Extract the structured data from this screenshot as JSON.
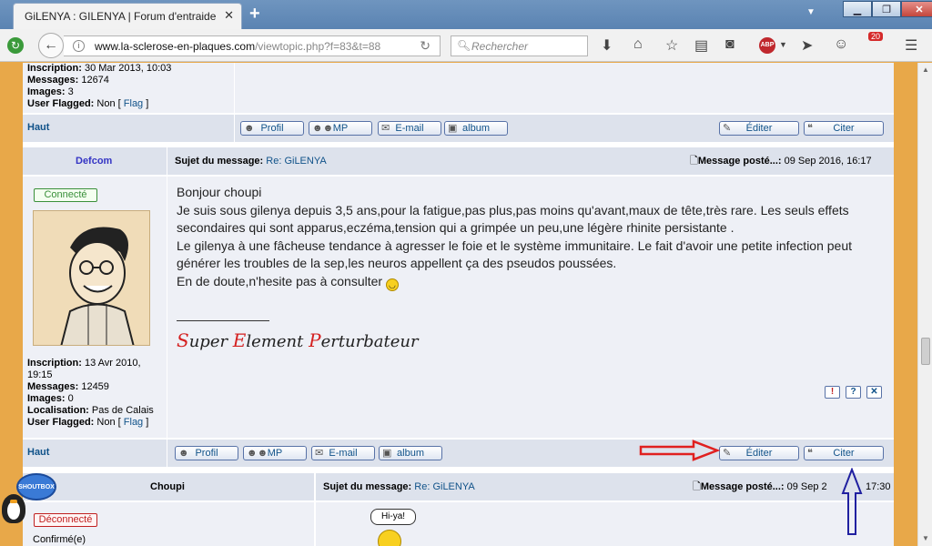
{
  "browser": {
    "tab_title": "GiLENYA : GILENYA | Forum d'entraide...",
    "tab_close": "✕",
    "new_tab": "+",
    "url_host": "www.la-sclerose-en-plaques.com",
    "url_path": "/viewtopic.php?f=83&t=88",
    "search_placeholder": "Rechercher",
    "notification_count": "20",
    "abp": "ABP"
  },
  "prev_post": {
    "inscription_label": "Inscription:",
    "inscription_value": "30 Mar 2013, 10:03",
    "messages_label": "Messages:",
    "messages_value": "12674",
    "images_label": "Images:",
    "images_value": "3",
    "flagged_label": "User Flagged:",
    "flagged_value": "Non",
    "flag_link": "Flag"
  },
  "buttons": {
    "haut": "Haut",
    "profil": "Profil",
    "mp": "MP",
    "email": "E-mail",
    "album": "album",
    "editer": "Éditer",
    "citer": "Citer"
  },
  "post": {
    "author": "Defcom",
    "status": "Connecté",
    "subject_label": "Sujet du message:",
    "subject_value": "Re: GiLENYA",
    "posted_label": "Message posté...:",
    "posted_value": "09 Sep 2016, 16:17",
    "body_lines": [
      "Bonjour choupi",
      "Je suis sous gilenya depuis 3,5 ans,pour la fatigue,pas plus,pas moins qu'avant,maux de tête,très rare. Les seuls effets",
      "secondaires qui sont apparus,eczéma,tension qui a grimpée un peu,une légère rhinite persistante .",
      "Le gilenya à une fâcheuse tendance à agresser le foie et le système immunitaire. Le fait d'avoir une petite infection peut",
      "générer les troubles de la sep,les neuros appellent ça des pseudos poussées.",
      "En de doute,n'hesite pas à consulter"
    ],
    "signature": [
      "S",
      "uper ",
      "E",
      "lement ",
      "P",
      "erturbateur"
    ],
    "inscription_label": "Inscription:",
    "inscription_value": "13 Avr 2010, 19:15",
    "messages_label": "Messages:",
    "messages_value": "12459",
    "images_label": "Images:",
    "images_value": "0",
    "localisation_label": "Localisation:",
    "localisation_value": "Pas de Calais",
    "flagged_label": "User Flagged:",
    "flagged_value": "Non",
    "flag_link": "Flag",
    "report_icon": "!",
    "info_icon": "?",
    "delete_icon": "✕"
  },
  "next_post": {
    "author": "Choupi",
    "status": "Déconnecté",
    "confirmed": "Confirmé(e)",
    "subject_label": "Sujet du message:",
    "subject_value": "Re: GiLENYA",
    "posted_label": "Message posté...:",
    "posted_value_a": "09 Sep 2",
    "posted_value_b": "17:30",
    "speech": "Hi-ya!"
  },
  "shoutbox": "SHOUTBOX",
  "colors": {
    "annotation_red": "#e02020",
    "annotation_blue": "#2020a0",
    "link_blue": "#105289",
    "page_bg": "#e8a849"
  }
}
